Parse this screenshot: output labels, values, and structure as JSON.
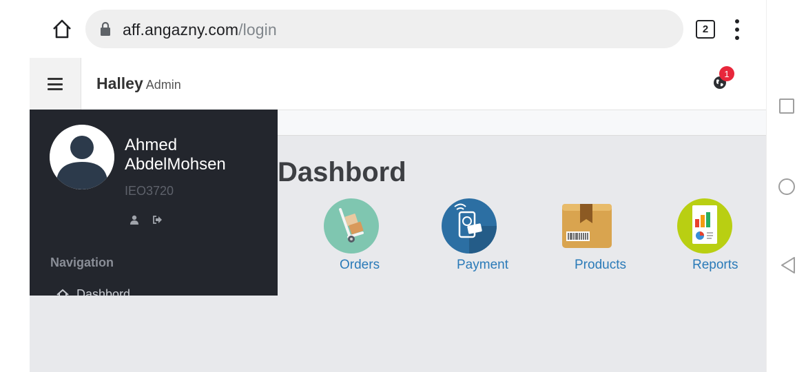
{
  "browser": {
    "url_domain": "aff.angazny.com",
    "url_path": "/login",
    "tab_count": "2"
  },
  "header": {
    "brand": "Halley",
    "brand_sub": "Admin",
    "notification_count": "1"
  },
  "sidebar": {
    "user_name": "Ahmed AbdelMohsen",
    "user_id": "IEO3720",
    "nav_heading": "Navigation",
    "items": [
      {
        "label": "Dashbord",
        "icon": "home-icon"
      }
    ]
  },
  "main": {
    "title": "Dashbord",
    "tiles": [
      {
        "label": "Orders",
        "icon": "hand-truck-icon"
      },
      {
        "label": "Payment",
        "icon": "payment-card-icon"
      },
      {
        "label": "Products",
        "icon": "product-box-icon"
      },
      {
        "label": "Reports",
        "icon": "report-chart-icon"
      }
    ]
  },
  "colors": {
    "sidebar_bg": "#23262d",
    "link_blue": "#2a7ab8",
    "badge_red": "#e8273b",
    "content_bg": "#e8e9ec"
  }
}
